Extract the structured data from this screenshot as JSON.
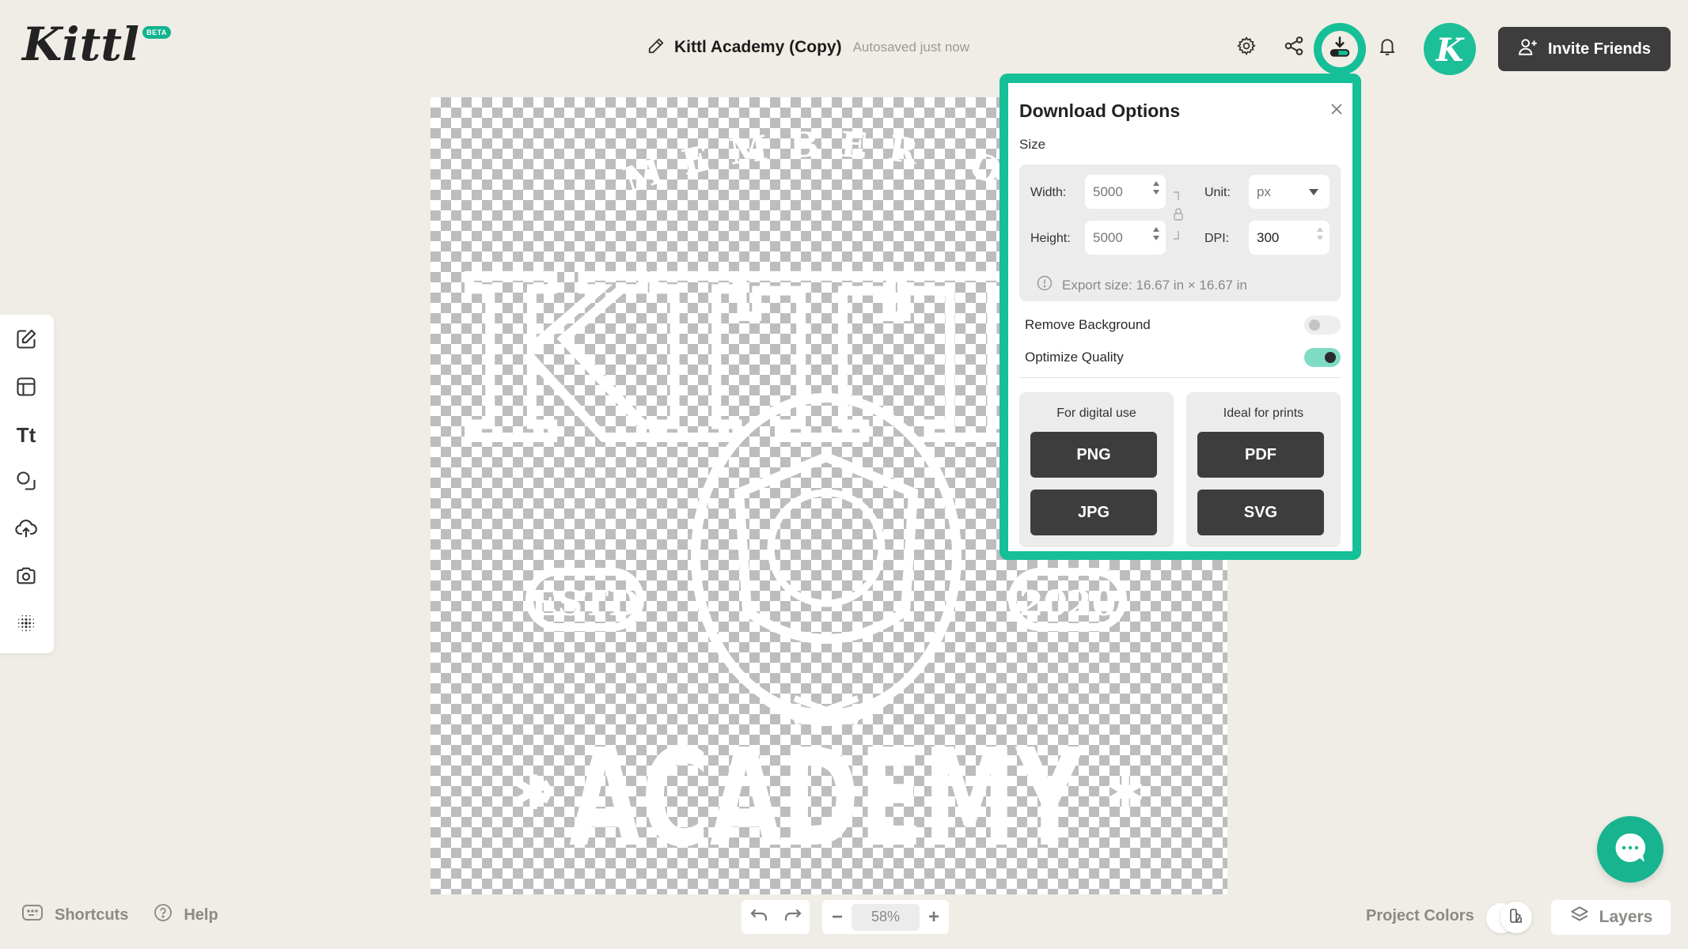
{
  "app": {
    "logo_text": "Kittl",
    "badge": "BETA",
    "brand_color": "#15bf98"
  },
  "header": {
    "project_title": "Kittl Academy (Copy)",
    "autosave_status": "Autosaved just now",
    "icons": [
      "pencil-icon",
      "settings-icon",
      "share-icon",
      "download-icon",
      "bell-icon"
    ],
    "avatar_initial": "K",
    "invite_label": "Invite Friends"
  },
  "sidebar": {
    "tools": [
      {
        "icon": "edit-icon",
        "name": "edit"
      },
      {
        "icon": "templates-icon",
        "name": "templates"
      },
      {
        "icon": "text-icon",
        "name": "text",
        "glyph": "Tt"
      },
      {
        "icon": "shapes-icon",
        "name": "elements"
      },
      {
        "icon": "upload-icon",
        "name": "uploads"
      },
      {
        "icon": "camera-icon",
        "name": "photos"
      },
      {
        "icon": "halftone-icon",
        "name": "effects"
      }
    ]
  },
  "canvas": {
    "artwork": {
      "top_text": "MEMBER OF",
      "main_text": "KITTL",
      "left_badge": "ESTD",
      "right_badge": "2020",
      "bottom_text": "ACADEMY"
    }
  },
  "download_options": {
    "title": "Download Options",
    "size_label": "Size",
    "width_label": "Width:",
    "width_value": "5000",
    "height_label": "Height:",
    "height_value": "5000",
    "unit_label": "Unit:",
    "unit_value": "px",
    "dpi_label": "DPI:",
    "dpi_value": "300",
    "export_size": "Export size: 16.67 in × 16.67 in",
    "remove_background": {
      "label": "Remove Background",
      "on": false
    },
    "optimize_quality": {
      "label": "Optimize Quality",
      "on": true
    },
    "digital": {
      "heading": "For digital use",
      "buttons": [
        "PNG",
        "JPG"
      ]
    },
    "print": {
      "heading": "Ideal for prints",
      "buttons": [
        "PDF",
        "SVG"
      ]
    }
  },
  "footer": {
    "shortcuts_label": "Shortcuts",
    "help_label": "Help",
    "zoom_value": "58%",
    "project_colors_label": "Project Colors",
    "layers_label": "Layers"
  }
}
